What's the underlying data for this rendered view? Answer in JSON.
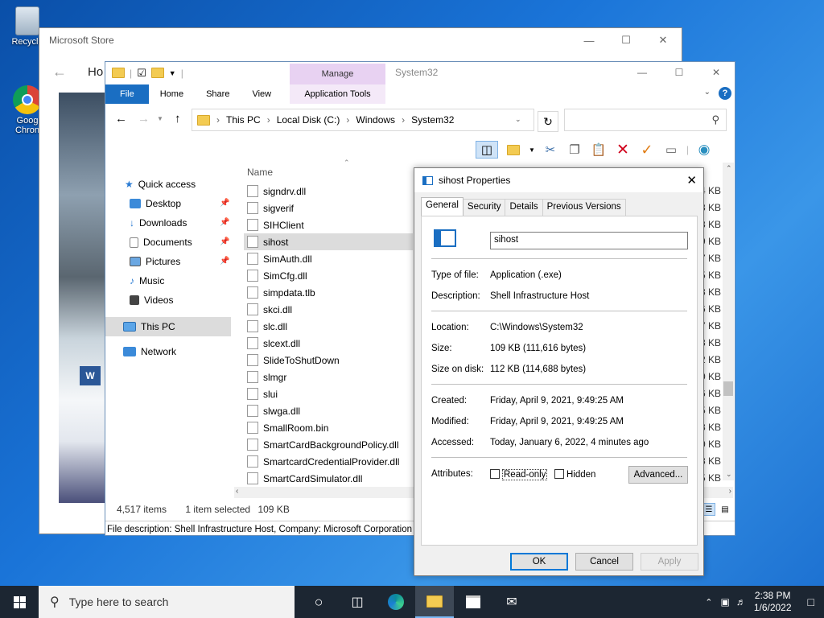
{
  "desktop": {
    "recycle_label": "Recycle",
    "chrome_label_1": "Goog",
    "chrome_label_2": "Chron"
  },
  "store": {
    "title": "Microsoft Store",
    "home_fragment": "Ho"
  },
  "explorer": {
    "app_title": "System32",
    "ribbon": {
      "file": "File",
      "home": "Home",
      "share": "Share",
      "view": "View",
      "manage": "Manage",
      "app_tools": "Application Tools"
    },
    "address": [
      "This PC",
      "Local Disk (C:)",
      "Windows",
      "System32"
    ],
    "column_name": "Name",
    "nav": {
      "quick_access": "Quick access",
      "desktop": "Desktop",
      "downloads": "Downloads",
      "documents": "Documents",
      "pictures": "Pictures",
      "music": "Music",
      "videos": "Videos",
      "this_pc": "This PC",
      "network": "Network"
    },
    "files": [
      "signdrv.dll",
      "sigverif",
      "SIHClient",
      "sihost",
      "SimAuth.dll",
      "SimCfg.dll",
      "simpdata.tlb",
      "skci.dll",
      "slc.dll",
      "slcext.dll",
      "SlideToShutDown",
      "slmgr",
      "slui",
      "slwga.dll",
      "SmallRoom.bin",
      "SmartCardBackgroundPolicy.dll",
      "SmartcardCredentialProvider.dll",
      "SmartCardSimulator.dll"
    ],
    "selected_file": "sihost",
    "sizes": [
      "4 KB",
      "8 KB",
      "8 KB",
      "9 KB",
      "7 KB",
      "5 KB",
      "3 KB",
      "6 KB",
      "7 KB",
      "3 KB",
      "2 KB",
      "0 KB",
      "6 KB",
      "5 KB",
      "8 KB",
      "0 KB",
      "8 KB",
      "5 KB"
    ],
    "status": {
      "items": "4,517 items",
      "selected": "1 item selected",
      "size": "109 KB"
    },
    "description": "File description: Shell Infrastructure Host, Company: Microsoft Corporation"
  },
  "props": {
    "title": "sihost Properties",
    "tabs": [
      "General",
      "Security",
      "Details",
      "Previous Versions"
    ],
    "name_value": "sihost",
    "type_label": "Type of file:",
    "type_value": "Application (.exe)",
    "desc_label": "Description:",
    "desc_value": "Shell Infrastructure Host",
    "location_label": "Location:",
    "location_value": "C:\\Windows\\System32",
    "size_label": "Size:",
    "size_value": "109 KB (111,616 bytes)",
    "size_disk_label": "Size on disk:",
    "size_disk_value": "112 KB (114,688 bytes)",
    "created_label": "Created:",
    "created_value": "Friday, April 9, 2021, 9:49:25 AM",
    "modified_label": "Modified:",
    "modified_value": "Friday, April 9, 2021, 9:49:25 AM",
    "accessed_label": "Accessed:",
    "accessed_value": "Today, January 6, 2022, 4 minutes ago",
    "attributes_label": "Attributes:",
    "readonly_label": "Read-only",
    "hidden_label": "Hidden",
    "advanced_label": "Advanced...",
    "ok_label": "OK",
    "cancel_label": "Cancel",
    "apply_label": "Apply"
  },
  "taskbar": {
    "search_placeholder": "Type here to search",
    "time": "2:38 PM",
    "date": "1/6/2022"
  }
}
